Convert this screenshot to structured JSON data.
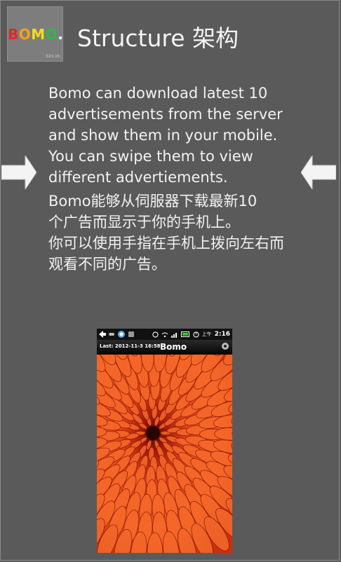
{
  "header": {
    "logo_letters": [
      "B",
      "O",
      "M",
      "O",
      "."
    ],
    "logo_colors": [
      "#e8242b",
      "#f6a21a",
      "#f2de14",
      "#31b54a",
      "#ffffff"
    ],
    "logo_subtext": "b2x.im",
    "title": "Structure 架构"
  },
  "content": {
    "english": "Bomo can download latest 10 advertisements from the server and show them in your mobile. You can swipe them to view different advertiements.",
    "chinese_1": "Bomo能够从伺服器下载最新10个广告而显示于你的手机上。",
    "chinese_2": "你可以使用手指在手机上拨向左右而观看不同的广告。"
  },
  "navigation": {
    "left_icon": "arrow-right-icon",
    "right_icon": "arrow-left-icon"
  },
  "phone": {
    "status_time": "2:16",
    "status_ampm": "上午",
    "last_label": "Last: 2012-11-3 16:58",
    "app_name": "Bomo"
  },
  "colors": {
    "background": "#5a5a5a",
    "text": "#f2f2f2",
    "flower": "#e8421a"
  }
}
